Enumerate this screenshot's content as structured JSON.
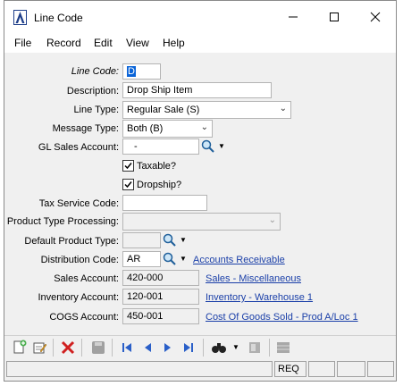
{
  "window": {
    "title": "Line Code"
  },
  "menu": [
    "File",
    "Record",
    "Edit",
    "View",
    "Help"
  ],
  "form": {
    "line_code": {
      "label": "Line Code:",
      "value": "D"
    },
    "description": {
      "label": "Description:",
      "value": "Drop Ship Item"
    },
    "line_type": {
      "label": "Line Type:",
      "value": "Regular Sale (S)"
    },
    "message_type": {
      "label": "Message Type:",
      "value": "Both (B)"
    },
    "gl_sales_account": {
      "label": "GL Sales Account:",
      "value": "-"
    },
    "taxable": {
      "label": "Taxable?",
      "checked": true
    },
    "dropship": {
      "label": "Dropship?",
      "checked": true
    },
    "tax_service_code": {
      "label": "Tax Service Code:",
      "value": ""
    },
    "product_type_processing": {
      "label": "Product Type Processing:",
      "value": ""
    },
    "default_product_type": {
      "label": "Default Product Type:",
      "value": ""
    },
    "distribution_code": {
      "label": "Distribution Code:",
      "value": "AR",
      "link": "Accounts Receivable"
    },
    "sales_account": {
      "label": "Sales Account:",
      "value": "420-000",
      "link": "Sales - Miscellaneous"
    },
    "inventory_account": {
      "label": "Inventory Account:",
      "value": "120-001",
      "link": "Inventory - Warehouse 1"
    },
    "cogs_account": {
      "label": "COGS Account:",
      "value": "450-001",
      "link": "Cost Of Goods Sold - Prod A/Loc 1"
    }
  },
  "status": {
    "req": "REQ"
  }
}
